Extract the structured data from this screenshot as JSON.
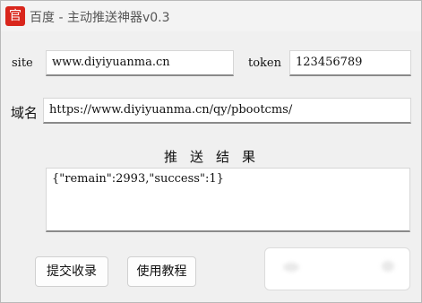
{
  "window": {
    "icon_glyph": "官",
    "title": "百度 - 主动推送神器v0.3"
  },
  "form": {
    "site_label": "site",
    "site_value": "www.diyiyuanma.cn",
    "token_label": "token",
    "token_value": "123456789",
    "domain_label": "域名",
    "domain_value": "https://www.diyiyuanma.cn/qy/pbootcms/"
  },
  "result": {
    "heading": "推送结果",
    "content": "{\"remain\":2993,\"success\":1}"
  },
  "buttons": {
    "submit_label": "提交收录",
    "tutorial_label": "使用教程"
  }
}
